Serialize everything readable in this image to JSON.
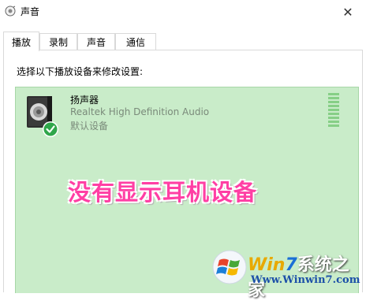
{
  "window": {
    "title": "声音",
    "close_symbol": "✕"
  },
  "tabs": [
    {
      "label": "播放",
      "active": true
    },
    {
      "label": "录制",
      "active": false
    },
    {
      "label": "声音",
      "active": false
    },
    {
      "label": "通信",
      "active": false
    }
  ],
  "panel": {
    "instruction": "选择以下播放设备来修改设置:"
  },
  "device": {
    "name": "扬声器",
    "driver": "Realtek High Definition Audio",
    "status": "默认设备",
    "icon": "speaker-icon",
    "badge_icon": "default-check-icon"
  },
  "overlay": {
    "text": "没有显示耳机设备"
  },
  "watermark": {
    "title_win": "Win",
    "title_7": "7",
    "title_rest": "系统之家",
    "url": "Www.Winwin7.com"
  },
  "colors": {
    "list_bg": "#c9ecc9",
    "overlay_text": "#ff3fa4",
    "check_badge": "#2fa64a",
    "url_blue": "#1b4fa8"
  }
}
